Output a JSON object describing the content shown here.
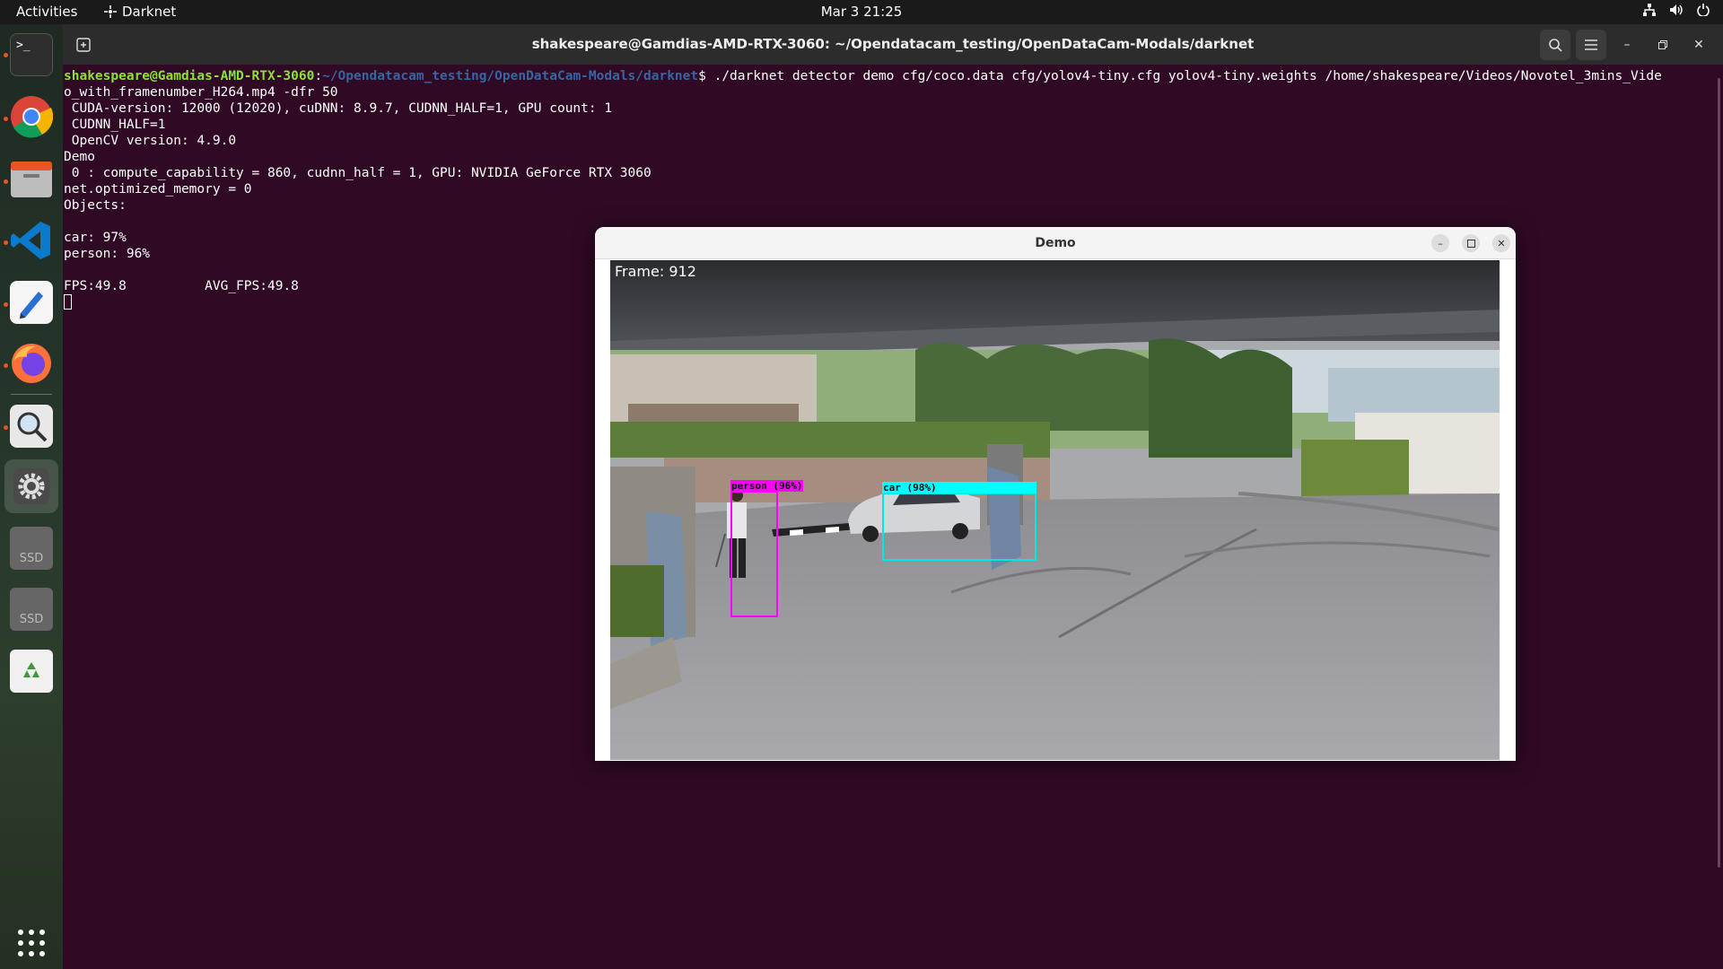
{
  "topbar": {
    "activities": "Activities",
    "app_name": "Darknet",
    "clock": "Mar 3  21:25",
    "tray_icons": [
      "network-icon",
      "volume-icon",
      "power-icon"
    ]
  },
  "dock": {
    "items": [
      "terminal",
      "chrome",
      "files",
      "vscode",
      "text-editor",
      "firefox",
      "search",
      "settings",
      "ssd-drive",
      "ssd-drive",
      "trash",
      "app-grid"
    ],
    "ssd_label": "SSD"
  },
  "terminal": {
    "title": "shakespeare@Gamdias-AMD-RTX-3060: ~/Opendatacam_testing/OpenDataCam-Modals/darknet",
    "prompt_user": "shakespeare@Gamdias-AMD-RTX-3060",
    "prompt_sep": ":",
    "prompt_path": "~/Opendatacam_testing/OpenDataCam-Modals/darknet",
    "prompt_symbol": "$ ",
    "command": "./darknet detector demo cfg/coco.data cfg/yolov4-tiny.cfg yolov4-tiny.weights /home/shakespeare/Videos/Novotel_3mins_Vide",
    "command_cont": "o_with_framenumber_H264.mp4 -dfr 50",
    "output": [
      " CUDA-version: 12000 (12020), cuDNN: 8.9.7, CUDNN_HALF=1, GPU count: 1",
      " CUDNN_HALF=1",
      " OpenCV version: 4.9.0",
      "Demo",
      " 0 : compute_capability = 860, cudnn_half = 1, GPU: NVIDIA GeForce RTX 3060",
      "net.optimized_memory = 0",
      "Objects:",
      "",
      "car: 97%",
      "person: 96%",
      "",
      "FPS:49.8          AVG_FPS:49.8"
    ]
  },
  "demo_window": {
    "title": "Demo",
    "frame_label": "Frame: 912",
    "detections": [
      {
        "label": "person (96%)",
        "color": "#ff00ff"
      },
      {
        "label": "car (98%)",
        "color": "#00ffff"
      }
    ]
  },
  "colors": {
    "terminal_bg": "#300a24",
    "prompt_user": "#8ae234",
    "prompt_path": "#3465a4",
    "accent": "#e95420"
  }
}
